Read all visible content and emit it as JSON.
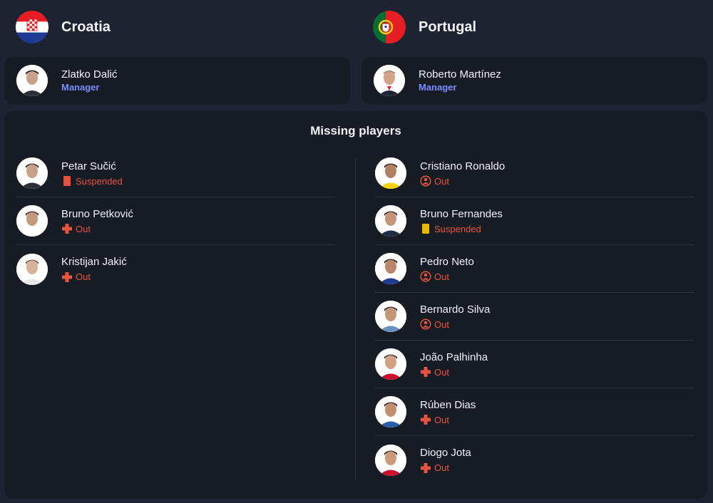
{
  "teams": {
    "home": {
      "name": "Croatia",
      "flag_icon": "croatia-flag",
      "manager": {
        "name": "Zlatko Dalić",
        "role": "Manager"
      }
    },
    "away": {
      "name": "Portugal",
      "flag_icon": "portugal-flag",
      "manager": {
        "name": "Roberto Martínez",
        "role": "Manager"
      }
    }
  },
  "missing": {
    "title": "Missing players",
    "home": [
      {
        "name": "Petar Sučić",
        "status": "Suspended",
        "icon": "red-card-icon"
      },
      {
        "name": "Bruno Petković",
        "status": "Out",
        "icon": "injury-cross-icon"
      },
      {
        "name": "Kristijan Jakić",
        "status": "Out",
        "icon": "injury-cross-icon"
      }
    ],
    "away": [
      {
        "name": "Cristiano Ronaldo",
        "status": "Out",
        "icon": "person-unavailable-icon"
      },
      {
        "name": "Bruno Fernandes",
        "status": "Suspended",
        "icon": "yellow-card-icon"
      },
      {
        "name": "Pedro Neto",
        "status": "Out",
        "icon": "person-unavailable-icon"
      },
      {
        "name": "Bernardo Silva",
        "status": "Out",
        "icon": "person-unavailable-icon"
      },
      {
        "name": "João Palhinha",
        "status": "Out",
        "icon": "injury-cross-icon"
      },
      {
        "name": "Rúben Dias",
        "status": "Out",
        "icon": "injury-cross-icon"
      },
      {
        "name": "Diogo Jota",
        "status": "Out",
        "icon": "injury-cross-icon"
      }
    ]
  },
  "colors": {
    "background": "#1d2330",
    "card": "#161b24",
    "manager_role": "#7b8cff",
    "status": "#e8533f",
    "red_card": "#e8533f",
    "yellow_card": "#e8b800"
  }
}
